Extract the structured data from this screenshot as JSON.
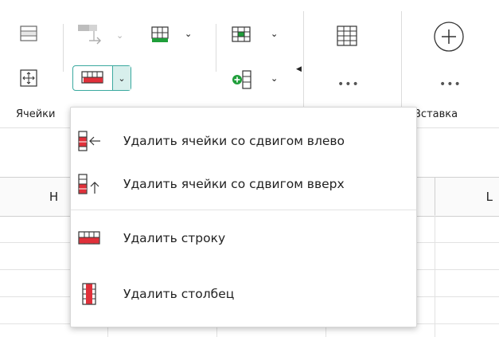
{
  "ribbon": {
    "groups": {
      "cells_label": "Ячейки",
      "insert_label": "Вставка"
    },
    "more_dots_1": "•••",
    "more_dots_2": "•••"
  },
  "columns": {
    "h_label": "H",
    "l_label": "L"
  },
  "dropdown": {
    "items": [
      {
        "label": "Удалить ячейки со сдвигом влево",
        "icon": "delete-cells-shift-left-icon"
      },
      {
        "label": "Удалить ячейки со сдвигом вверх",
        "icon": "delete-cells-shift-up-icon"
      },
      {
        "label": "Удалить строку",
        "icon": "delete-row-icon"
      },
      {
        "label": "Удалить столбец",
        "icon": "delete-column-icon"
      }
    ]
  },
  "colors": {
    "accent": "#3aa99f",
    "accent_bg": "#d8efec",
    "red": "#e0303a",
    "green": "#1f9e3a"
  }
}
